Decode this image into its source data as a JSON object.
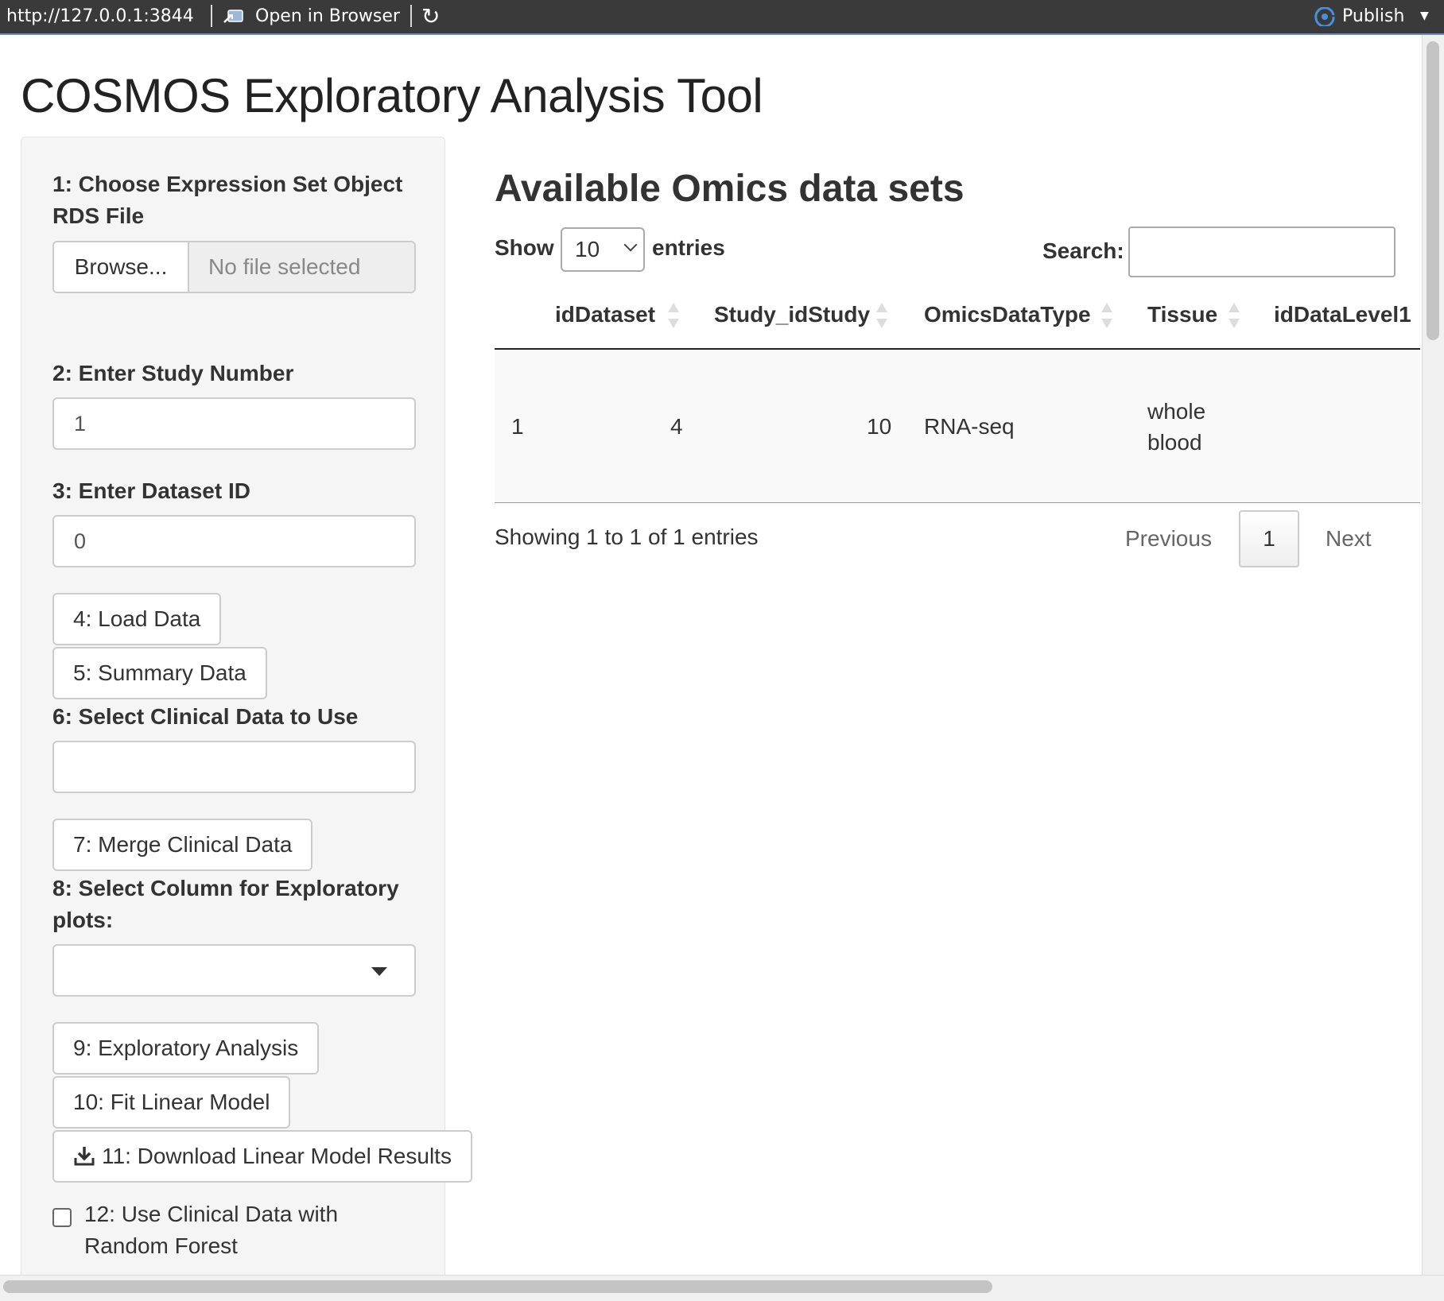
{
  "toolbar": {
    "url": "http://127.0.0.1:3844",
    "open_in_browser": "Open in Browser",
    "publish": "Publish",
    "icons": [
      "open-in-browser-icon",
      "refresh-icon",
      "publish-icon",
      "caret-down-icon"
    ]
  },
  "app": {
    "title": "COSMOS Exploratory Analysis Tool"
  },
  "sidebar": {
    "step1_label": "1: Choose Expression Set Object RDS File",
    "browse_label": "Browse...",
    "file_placeholder": "No file selected",
    "step2_label": "2: Enter Study Number",
    "study_number": "1",
    "step3_label": "3: Enter Dataset ID",
    "dataset_id": "0",
    "load_button": "4: Load Data",
    "summary_button": "5: Summary Data",
    "step6_label": "6: Select Clinical Data to Use",
    "clinical_value": "",
    "merge_button": "7: Merge Clinical Data",
    "step8_label": "8: Select Column for Exploratory plots:",
    "column_value": "",
    "exploratory_button": "9: Exploratory Analysis",
    "fit_button": "10: Fit Linear Model",
    "download_button": "11: Download Linear Model Results",
    "checkbox_label": "12: Use Clinical Data with Random Forest",
    "checkbox_checked": false
  },
  "main": {
    "title": "Available Omics data sets",
    "show_label": "Show",
    "page_length": "10",
    "entries_label": "entries",
    "search_label": "Search:",
    "search_value": "",
    "columns": [
      "idDataset",
      "Study_idStudy",
      "OmicsDataType",
      "Tissue",
      "idDataLevel1"
    ],
    "rows": [
      {
        "index": "1",
        "idDataset": "4",
        "Study_idStudy": "10",
        "OmicsDataType": "RNA-seq",
        "Tissue_line1": "whole",
        "Tissue_line2": "blood",
        "idDataLevel1": ""
      }
    ],
    "info": "Showing 1 to 1 of 1 entries",
    "pagination": {
      "previous": "Previous",
      "current": "1",
      "next": "Next"
    }
  }
}
